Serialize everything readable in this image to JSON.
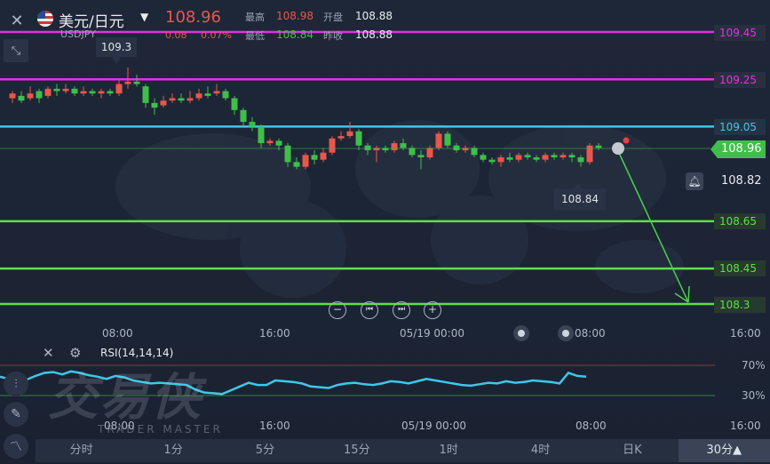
{
  "header": {
    "pair": "美元/日元",
    "code": "USDJPY",
    "price": "108.96",
    "change": "0.08",
    "change_pct": "0.07%",
    "high_label": "最高",
    "high": "108.98",
    "low_label": "最低",
    "low": "108.84",
    "open_label": "开盘",
    "open": "108.88",
    "prev_label": "昨收",
    "prev": "108.88"
  },
  "levels": {
    "l1": "109.45",
    "l2": "109.25",
    "l3": "109.05",
    "current": "108.96",
    "bell": "108.82",
    "l4": "108.65",
    "l5": "108.45",
    "l6": "108.3"
  },
  "callouts": {
    "high": "109.3",
    "low": "108.84"
  },
  "time_axis": [
    "08:00",
    "16:00",
    "05/19 00:00",
    "08:00",
    "16:00"
  ],
  "rsi": {
    "label": "RSI(14,14,14)",
    "upper": "70%",
    "lower": "30%",
    "time_axis": [
      "08:00",
      "16:00",
      "05/19 00:00",
      "08:00",
      "16:00"
    ]
  },
  "watermark": {
    "brand": "交易侠",
    "sub": "TRADER MASTER"
  },
  "timeframes": [
    "分时",
    "1分",
    "5分",
    "15分",
    "1时",
    "4时",
    "日K",
    "30分▲"
  ],
  "icons": {
    "close": "close-icon",
    "collapse": "collapse-icon",
    "flag": "us-flag-icon",
    "dropdown": "caret-down-icon",
    "bell": "bell-icon",
    "settings": "gear-icon",
    "draw": "pencil-icon",
    "indicator": "indicator-icon"
  },
  "colors": {
    "up": "#e8574c",
    "down": "#3fbf4a",
    "magenta": "#e033e0",
    "cyan": "#3ec8e8",
    "green_line": "#5ee046"
  },
  "chart_data": {
    "type": "candlestick",
    "ylim": [
      108.25,
      109.5
    ],
    "candles": [
      {
        "o": 109.17,
        "c": 109.19,
        "h": 109.2,
        "l": 109.15
      },
      {
        "o": 109.18,
        "c": 109.16,
        "h": 109.2,
        "l": 109.15
      },
      {
        "o": 109.17,
        "c": 109.19,
        "h": 109.22,
        "l": 109.16
      },
      {
        "o": 109.2,
        "c": 109.17,
        "h": 109.21,
        "l": 109.15
      },
      {
        "o": 109.18,
        "c": 109.21,
        "h": 109.22,
        "l": 109.17
      },
      {
        "o": 109.21,
        "c": 109.2,
        "h": 109.23,
        "l": 109.18
      },
      {
        "o": 109.2,
        "c": 109.21,
        "h": 109.23,
        "l": 109.19
      },
      {
        "o": 109.21,
        "c": 109.19,
        "h": 109.22,
        "l": 109.18
      },
      {
        "o": 109.19,
        "c": 109.2,
        "h": 109.22,
        "l": 109.18
      },
      {
        "o": 109.2,
        "c": 109.19,
        "h": 109.21,
        "l": 109.18
      },
      {
        "o": 109.19,
        "c": 109.2,
        "h": 109.21,
        "l": 109.17
      },
      {
        "o": 109.2,
        "c": 109.19,
        "h": 109.21,
        "l": 109.18
      },
      {
        "o": 109.19,
        "c": 109.23,
        "h": 109.25,
        "l": 109.18
      },
      {
        "o": 109.23,
        "c": 109.24,
        "h": 109.3,
        "l": 109.21
      },
      {
        "o": 109.24,
        "c": 109.23,
        "h": 109.27,
        "l": 109.22
      },
      {
        "o": 109.22,
        "c": 109.15,
        "h": 109.23,
        "l": 109.13
      },
      {
        "o": 109.15,
        "c": 109.13,
        "h": 109.17,
        "l": 109.1
      },
      {
        "o": 109.14,
        "c": 109.16,
        "h": 109.18,
        "l": 109.13
      },
      {
        "o": 109.16,
        "c": 109.17,
        "h": 109.19,
        "l": 109.15
      },
      {
        "o": 109.17,
        "c": 109.16,
        "h": 109.19,
        "l": 109.15
      },
      {
        "o": 109.16,
        "c": 109.17,
        "h": 109.2,
        "l": 109.15
      },
      {
        "o": 109.17,
        "c": 109.19,
        "h": 109.21,
        "l": 109.16
      },
      {
        "o": 109.19,
        "c": 109.18,
        "h": 109.22,
        "l": 109.17
      },
      {
        "o": 109.19,
        "c": 109.2,
        "h": 109.23,
        "l": 109.18
      },
      {
        "o": 109.2,
        "c": 109.17,
        "h": 109.21,
        "l": 109.16
      },
      {
        "o": 109.17,
        "c": 109.12,
        "h": 109.18,
        "l": 109.1
      },
      {
        "o": 109.12,
        "c": 109.07,
        "h": 109.13,
        "l": 109.05
      },
      {
        "o": 109.07,
        "c": 109.05,
        "h": 109.09,
        "l": 109.03
      },
      {
        "o": 109.05,
        "c": 108.98,
        "h": 109.06,
        "l": 108.96
      },
      {
        "o": 108.98,
        "c": 108.99,
        "h": 109.0,
        "l": 108.97
      },
      {
        "o": 108.99,
        "c": 108.97,
        "h": 109.0,
        "l": 108.95
      },
      {
        "o": 108.97,
        "c": 108.9,
        "h": 108.98,
        "l": 108.88
      },
      {
        "o": 108.9,
        "c": 108.88,
        "h": 108.92,
        "l": 108.87
      },
      {
        "o": 108.88,
        "c": 108.93,
        "h": 108.94,
        "l": 108.87
      },
      {
        "o": 108.93,
        "c": 108.91,
        "h": 108.95,
        "l": 108.89
      },
      {
        "o": 108.91,
        "c": 108.94,
        "h": 108.96,
        "l": 108.9
      },
      {
        "o": 108.94,
        "c": 109.0,
        "h": 109.01,
        "l": 108.93
      },
      {
        "o": 109.0,
        "c": 109.01,
        "h": 109.03,
        "l": 108.99
      },
      {
        "o": 109.01,
        "c": 109.03,
        "h": 109.07,
        "l": 109.0
      },
      {
        "o": 109.03,
        "c": 108.97,
        "h": 109.04,
        "l": 108.95
      },
      {
        "o": 108.97,
        "c": 108.95,
        "h": 108.98,
        "l": 108.93
      },
      {
        "o": 108.95,
        "c": 108.96,
        "h": 108.97,
        "l": 108.9
      },
      {
        "o": 108.96,
        "c": 108.95,
        "h": 108.97,
        "l": 108.94
      },
      {
        "o": 108.95,
        "c": 108.98,
        "h": 108.99,
        "l": 108.94
      },
      {
        "o": 108.98,
        "c": 108.96,
        "h": 109.0,
        "l": 108.95
      },
      {
        "o": 108.96,
        "c": 108.93,
        "h": 108.97,
        "l": 108.92
      },
      {
        "o": 108.93,
        "c": 108.92,
        "h": 108.95,
        "l": 108.87
      },
      {
        "o": 108.92,
        "c": 108.96,
        "h": 108.97,
        "l": 108.91
      },
      {
        "o": 108.96,
        "c": 109.02,
        "h": 109.03,
        "l": 108.95
      },
      {
        "o": 109.02,
        "c": 108.97,
        "h": 109.03,
        "l": 108.96
      },
      {
        "o": 108.97,
        "c": 108.95,
        "h": 108.98,
        "l": 108.94
      },
      {
        "o": 108.95,
        "c": 108.96,
        "h": 108.97,
        "l": 108.94
      },
      {
        "o": 108.96,
        "c": 108.93,
        "h": 108.97,
        "l": 108.92
      },
      {
        "o": 108.93,
        "c": 108.91,
        "h": 108.94,
        "l": 108.9
      },
      {
        "o": 108.91,
        "c": 108.9,
        "h": 108.92,
        "l": 108.89
      },
      {
        "o": 108.9,
        "c": 108.92,
        "h": 108.93,
        "l": 108.88
      },
      {
        "o": 108.92,
        "c": 108.91,
        "h": 108.94,
        "l": 108.9
      },
      {
        "o": 108.91,
        "c": 108.93,
        "h": 108.94,
        "l": 108.9
      },
      {
        "o": 108.93,
        "c": 108.92,
        "h": 108.94,
        "l": 108.91
      },
      {
        "o": 108.92,
        "c": 108.91,
        "h": 108.93,
        "l": 108.9
      },
      {
        "o": 108.91,
        "c": 108.93,
        "h": 108.94,
        "l": 108.9
      },
      {
        "o": 108.93,
        "c": 108.92,
        "h": 108.94,
        "l": 108.91
      },
      {
        "o": 108.92,
        "c": 108.93,
        "h": 108.94,
        "l": 108.91
      },
      {
        "o": 108.93,
        "c": 108.92,
        "h": 108.94,
        "l": 108.9
      },
      {
        "o": 108.92,
        "c": 108.9,
        "h": 108.93,
        "l": 108.88
      },
      {
        "o": 108.9,
        "c": 108.97,
        "h": 108.98,
        "l": 108.89
      },
      {
        "o": 108.97,
        "c": 108.96,
        "h": 108.98,
        "l": 108.95
      }
    ],
    "rsi": [
      55,
      52,
      58,
      51,
      56,
      60,
      61,
      58,
      62,
      60,
      57,
      55,
      52,
      56,
      54,
      50,
      48,
      46,
      47,
      46,
      45,
      44,
      38,
      34,
      33,
      32,
      37,
      42,
      47,
      44,
      44,
      50,
      49,
      48,
      46,
      42,
      41,
      40,
      44,
      46,
      47,
      45,
      44,
      46,
      49,
      48,
      46,
      49,
      52,
      50,
      48,
      46,
      44,
      43,
      45,
      47,
      46,
      49,
      47,
      48,
      50,
      49,
      48,
      46,
      60,
      56,
      55
    ]
  }
}
